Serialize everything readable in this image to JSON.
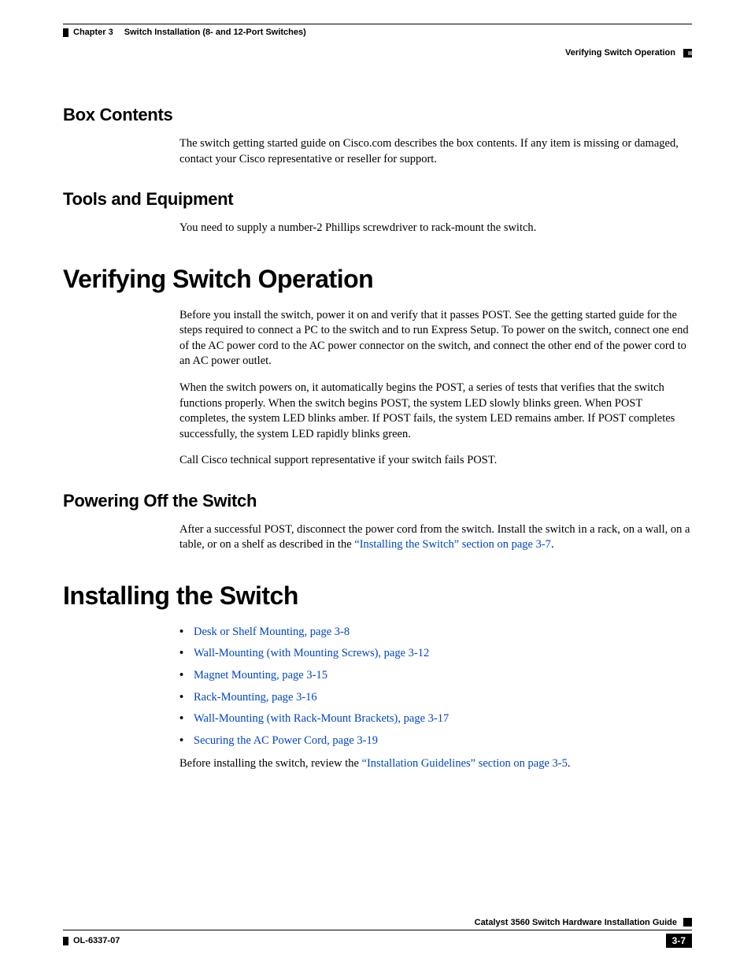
{
  "header": {
    "chapter_label": "Chapter 3",
    "chapter_title": "Switch Installation (8- and 12-Port Switches)",
    "section_title": "Verifying Switch Operation"
  },
  "sections": {
    "box_contents": {
      "heading": "Box Contents",
      "p1": "The switch getting started guide on Cisco.com describes the box contents. If any item is missing or damaged, contact your Cisco representative or reseller for support."
    },
    "tools": {
      "heading": "Tools and Equipment",
      "p1": "You need to supply a number-2 Phillips screwdriver to rack-mount the switch."
    },
    "verifying": {
      "heading": "Verifying Switch Operation",
      "p1": "Before you install the switch, power it on and verify that it passes POST. See the getting started guide for the steps required to connect a PC to the switch and to run Express Setup. To power on the switch, connect one end of the AC power cord to the AC power connector on the switch, and connect the other end of the power cord to an AC power outlet.",
      "p2": "When the switch powers on, it automatically begins the POST, a series of tests that verifies that the switch functions properly. When the switch begins POST, the system LED slowly blinks green. When POST completes, the system LED blinks amber. If POST fails, the system LED remains amber. If POST completes successfully, the system LED rapidly blinks green.",
      "p3": "Call Cisco technical support representative if your switch fails POST."
    },
    "powering_off": {
      "heading": "Powering Off the Switch",
      "p1_pre": "After a successful POST, disconnect the power cord from the switch. Install the switch in a rack, on a wall, on a table, or on a shelf as described in the ",
      "p1_link": "“Installing the Switch” section on page 3-7",
      "p1_post": "."
    },
    "installing": {
      "heading": "Installing the Switch",
      "items": [
        "Desk or Shelf Mounting, page 3-8",
        "Wall-Mounting (with Mounting Screws), page 3-12",
        "Magnet Mounting, page 3-15",
        "Rack-Mounting, page 3-16",
        "Wall-Mounting (with Rack-Mount Brackets), page 3-17",
        "Securing the AC Power Cord, page 3-19"
      ],
      "p_after_pre": "Before installing the switch, review the ",
      "p_after_link": "“Installation Guidelines” section on page 3-5",
      "p_after_post": "."
    }
  },
  "footer": {
    "guide_title": "Catalyst 3560 Switch Hardware Installation Guide",
    "doc_number": "OL-6337-07",
    "page_number": "3-7"
  }
}
